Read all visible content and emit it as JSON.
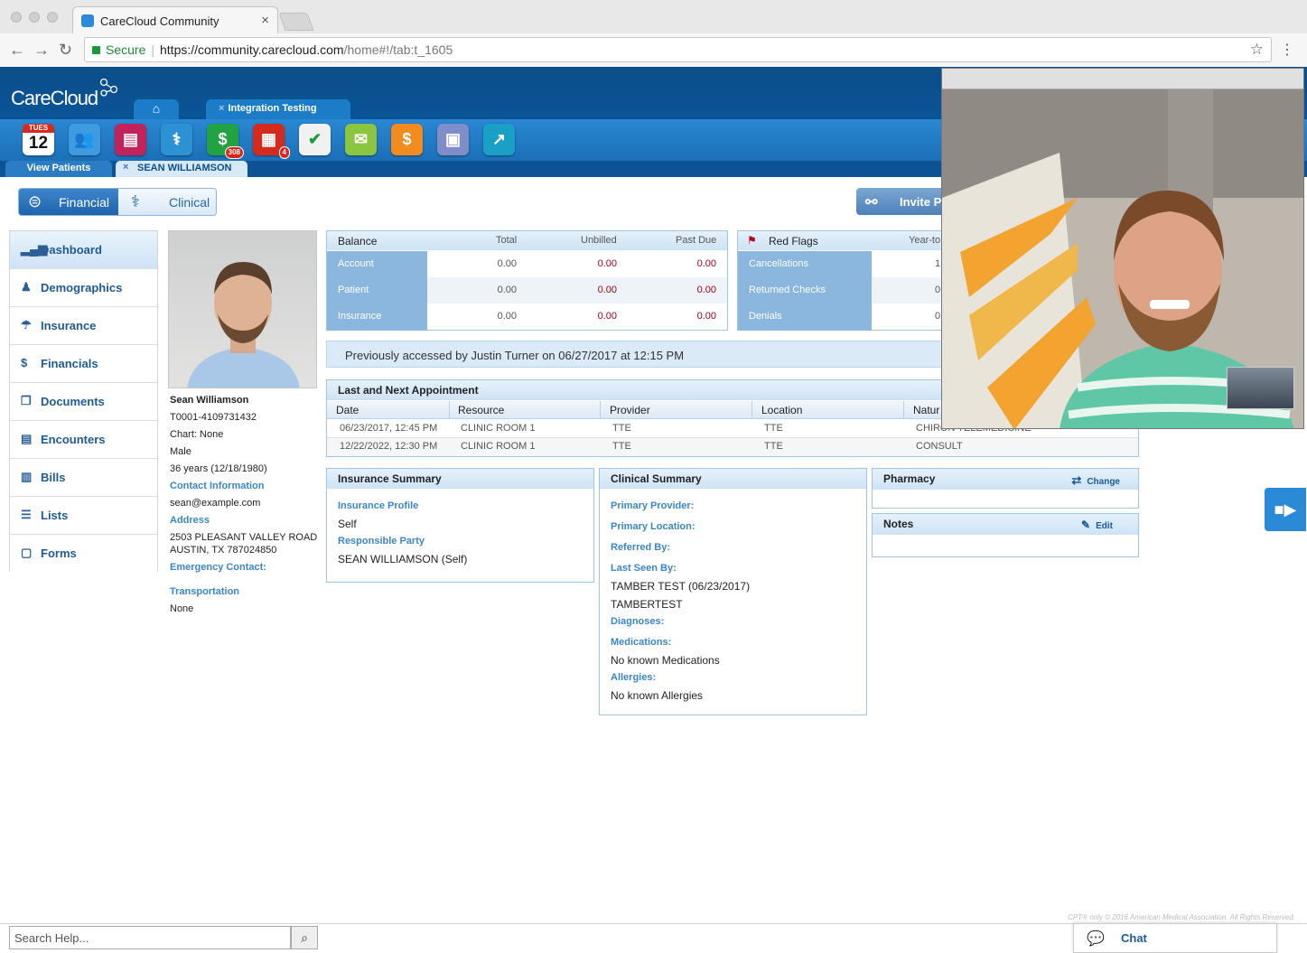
{
  "browser": {
    "tab_title": "CareCloud Community",
    "secure_label": "Secure",
    "url_host": "https://community.carecloud.com",
    "url_path": "/home#!/tab:t_1605"
  },
  "app": {
    "logo": "CareCloud",
    "open_tab": "Integration Testing",
    "calendar_day": "TUES",
    "calendar_date": "12",
    "badge_financial": "308",
    "badge_documents": "4",
    "subtab_view_patients": "View Patients",
    "subtab_patient": "SEAN WILLIAMSON"
  },
  "toggle": {
    "financial": "Financial",
    "clinical": "Clinical"
  },
  "invite_label": "Invite P",
  "nav": [
    {
      "label": "Dashboard",
      "icon": "bar-chart-icon",
      "active": true
    },
    {
      "label": "Demographics",
      "icon": "person-icon"
    },
    {
      "label": "Insurance",
      "icon": "umbrella-icon"
    },
    {
      "label": "Financials",
      "icon": "dollar-icon"
    },
    {
      "label": "Documents",
      "icon": "documents-icon"
    },
    {
      "label": "Encounters",
      "icon": "clipboard-icon"
    },
    {
      "label": "Bills",
      "icon": "bill-icon"
    },
    {
      "label": "Lists",
      "icon": "list-icon"
    },
    {
      "label": "Forms",
      "icon": "form-icon"
    }
  ],
  "patient": {
    "name": "Sean Williamson",
    "id": "T0001-4109731432",
    "chart": "Chart: None",
    "gender": "Male",
    "age": "36 years (12/18/1980)",
    "contact_label": "Contact Information",
    "email": "sean@example.com",
    "address_label": "Address",
    "address_line1": "2503 PLEASANT VALLEY ROAD",
    "address_line2": "AUSTIN, TX 787024850",
    "emergency_label": "Emergency Contact:",
    "transportation_label": "Transportation",
    "transportation": "None"
  },
  "balance": {
    "title": "Balance",
    "columns": [
      "Total",
      "Unbilled",
      "Past Due"
    ],
    "rows": [
      {
        "label": "Account",
        "total": "0.00",
        "unbilled": "0.00",
        "past_due": "0.00"
      },
      {
        "label": "Patient",
        "total": "0.00",
        "unbilled": "0.00",
        "past_due": "0.00"
      },
      {
        "label": "Insurance",
        "total": "0.00",
        "unbilled": "0.00",
        "past_due": "0.00"
      }
    ]
  },
  "red_flags": {
    "title": "Red Flags",
    "column": "Year-to",
    "rows": [
      {
        "label": "Cancellations",
        "value": "1"
      },
      {
        "label": "Returned Checks",
        "value": "0"
      },
      {
        "label": "Denials",
        "value": "0"
      }
    ]
  },
  "accessed": "Previously accessed by Justin Turner on 06/27/2017 at 12:15 PM",
  "appointments": {
    "title": "Last and Next Appointment",
    "columns": [
      "Date",
      "Resource",
      "Provider",
      "Location",
      "Natur"
    ],
    "rows": [
      {
        "date": "06/23/2017, 12:45 PM",
        "resource": "CLINIC ROOM 1",
        "provider": "TTE",
        "location": "TTE",
        "nature": "CHIRON TELEMEDICINE"
      },
      {
        "date": "12/22/2022, 12:30 PM",
        "resource": "CLINIC ROOM 1",
        "provider": "TTE",
        "location": "TTE",
        "nature": "CONSULT"
      }
    ]
  },
  "insurance_summary": {
    "title": "Insurance Summary",
    "profile_label": "Insurance Profile",
    "profile": "Self",
    "responsible_label": "Responsible Party",
    "responsible": "SEAN WILLIAMSON (Self)"
  },
  "clinical_summary": {
    "title": "Clinical Summary",
    "primary_provider_label": "Primary Provider:",
    "primary_location_label": "Primary Location:",
    "referred_by_label": "Referred By:",
    "last_seen_label": "Last Seen By:",
    "last_seen_1": "TAMBER TEST (06/23/2017)",
    "last_seen_2": "TAMBERTEST",
    "diagnoses_label": "Diagnoses:",
    "medications_label": "Medications:",
    "medications": "No known Medications",
    "allergies_label": "Allergies:",
    "allergies": "No known Allergies"
  },
  "pharmacy": {
    "title": "Pharmacy",
    "action": "Change"
  },
  "notes": {
    "title": "Notes",
    "action": "Edit"
  },
  "footer": {
    "copyright": "CPT® only © 2016 American Medical Association. All Rights Reserved.",
    "search_placeholder": "Search Help...",
    "chat": "Chat"
  },
  "colors": {
    "brand_blue": "#0b4f8a",
    "accent_blue": "#2a8ad6",
    "past_due_red": "#a4001a"
  }
}
